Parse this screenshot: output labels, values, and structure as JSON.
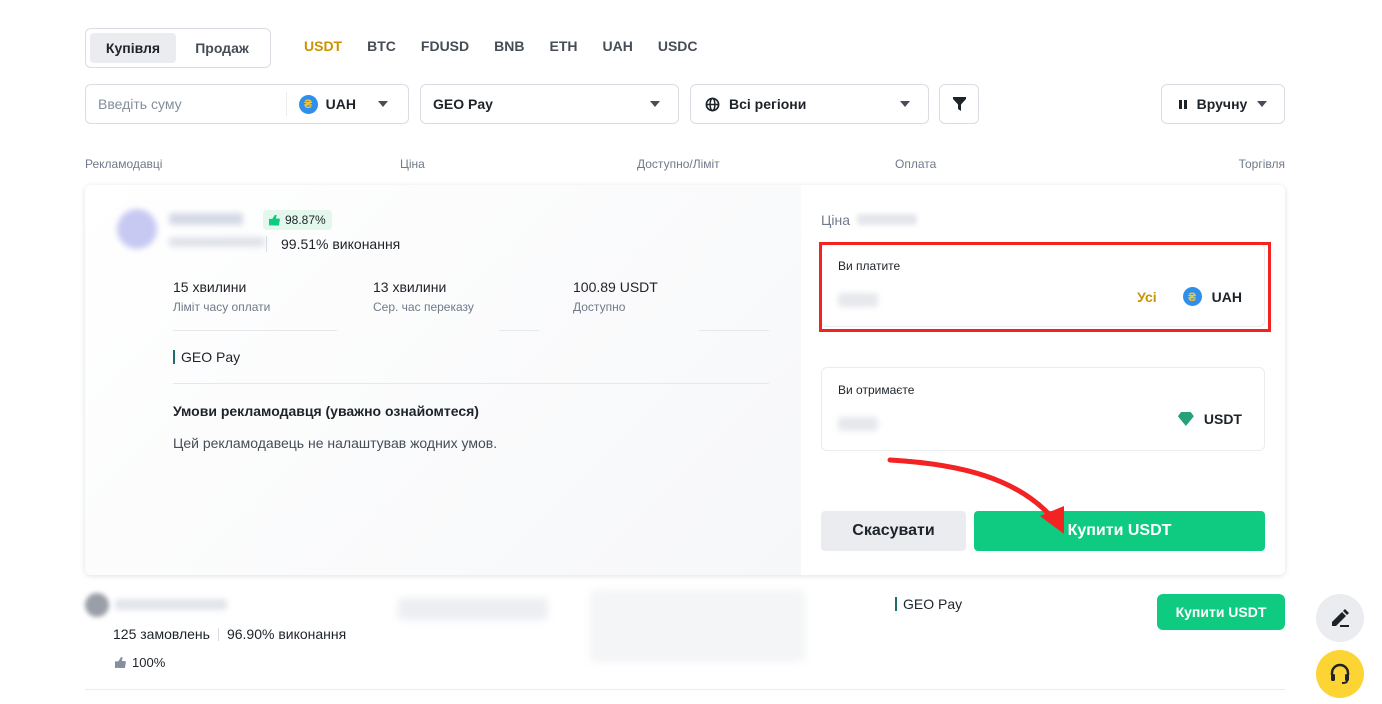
{
  "trade_tabs": {
    "buy": "Купівля",
    "sell": "Продаж"
  },
  "assets": [
    "USDT",
    "BTC",
    "FDUSD",
    "BNB",
    "ETH",
    "UAH",
    "USDC"
  ],
  "active_asset": "USDT",
  "filters": {
    "amount_placeholder": "Введіть суму",
    "fiat": "UAH",
    "payment": "GEO Pay",
    "region": "Всі регіони",
    "refresh": "Вручну"
  },
  "columns": {
    "advertisers": "Рекламодавці",
    "price": "Ціна",
    "limit": "Доступно/Ліміт",
    "payment": "Оплата",
    "trade": "Торгівля"
  },
  "expanded_ad": {
    "positive_rate": "98.87%",
    "completion": "99.51% виконання",
    "stats": [
      {
        "value": "15 хвилини",
        "label": "Ліміт часу оплати"
      },
      {
        "value": "13 хвилини",
        "label": "Сер. час переказу"
      },
      {
        "value": "100.89 USDT",
        "label": "Доступно"
      }
    ],
    "payment_method": "GEO Pay",
    "terms_title": "Умови рекламодавця (уважно ознайомтеся)",
    "terms_text": "Цей рекламодавець не налаштував жодних умов.",
    "price_label": "Ціна",
    "pay_box": {
      "label": "Ви платите",
      "all_label": "Усі",
      "currency": "UAH"
    },
    "receive_box": {
      "label": "Ви отримаєте",
      "currency": "USDT"
    },
    "cancel_label": "Скасувати",
    "buy_label": "Купити USDT"
  },
  "second_ad": {
    "orders": "125 замовлень",
    "completion": "96.90% виконання",
    "positive_rate": "100%",
    "payment_method": "GEO Pay",
    "buy_label": "Купити USDT"
  },
  "colors": {
    "accent_gold": "#C99400",
    "buy_green": "#0ECB81",
    "annotation_red": "#F42323",
    "support_yellow": "#FCD535"
  }
}
